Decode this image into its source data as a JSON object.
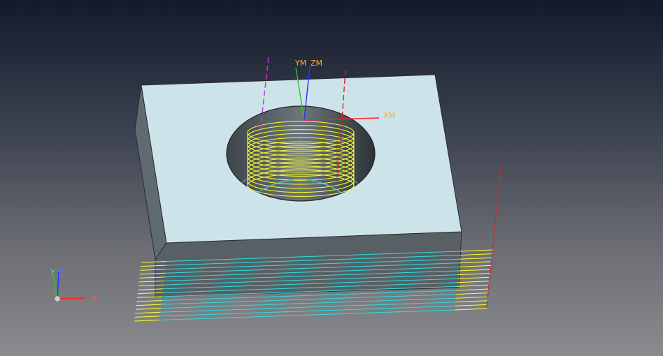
{
  "viewport": {
    "background_top": "#141a2a",
    "background_bottom": "#8a8b8e"
  },
  "colors": {
    "top_face": "#cde3ea",
    "side_face": "#5f6b70",
    "front_face": "#5a6266",
    "toolpath_thread": "#ffff33",
    "toolpath_floor": "#33dddd",
    "axis_x": "#ff2222",
    "axis_y": "#22cc22",
    "axis_z": "#2233ff",
    "csys_label": "#ffaa33",
    "tool_axis_magenta": "#cc33cc",
    "tool_axis_red": "#dd2222"
  },
  "work_csys": {
    "y_label": "YM",
    "z_label": "ZM",
    "x_label": "XM"
  },
  "view_triad": {
    "x_label": "X",
    "y_label": "Y",
    "z_label": "Z"
  },
  "icons": {
    "triad_origin": "sphere-icon"
  }
}
